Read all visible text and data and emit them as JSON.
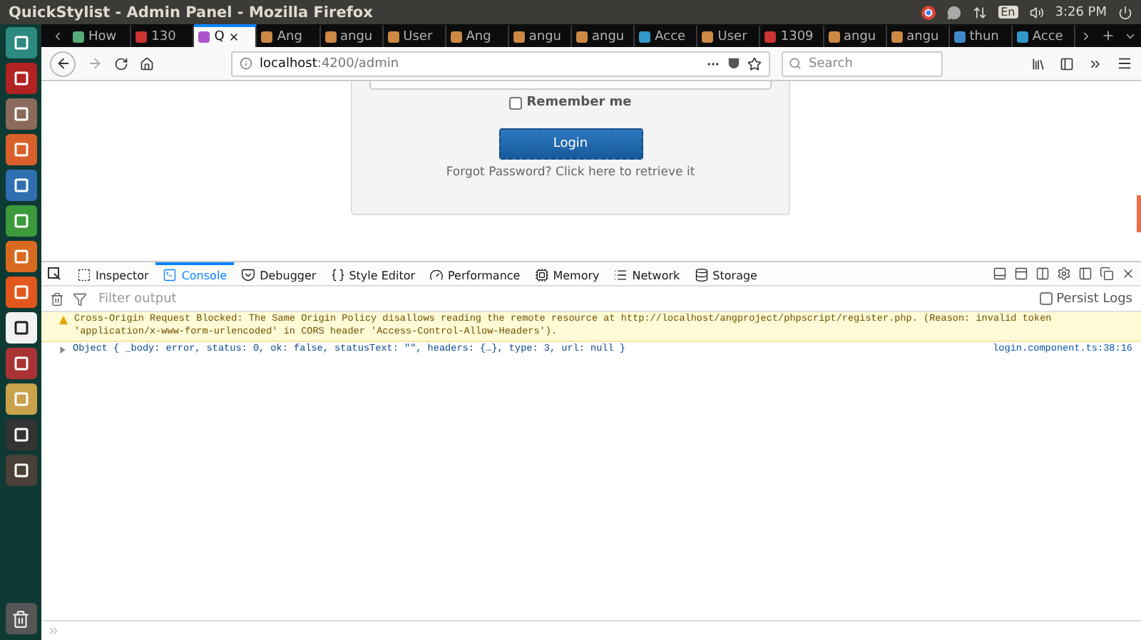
{
  "top_panel": {
    "title": "QuickStylist - Admin Panel - Mozilla Firefox",
    "keyboard_layout": "En",
    "clock": "3:26 PM"
  },
  "tabs": [
    {
      "label": "How",
      "selected": false
    },
    {
      "label": "130",
      "selected": false
    },
    {
      "label": "Q",
      "selected": true
    },
    {
      "label": "Ang",
      "selected": false
    },
    {
      "label": "angu",
      "selected": false
    },
    {
      "label": "User",
      "selected": false
    },
    {
      "label": "Ang",
      "selected": false
    },
    {
      "label": "angu",
      "selected": false
    },
    {
      "label": "angu",
      "selected": false
    },
    {
      "label": "Acce",
      "selected": false
    },
    {
      "label": "User",
      "selected": false
    },
    {
      "label": "1309",
      "selected": false
    },
    {
      "label": "angu",
      "selected": false
    },
    {
      "label": "angu",
      "selected": false
    },
    {
      "label": "thun",
      "selected": false
    },
    {
      "label": "Acce",
      "selected": false
    }
  ],
  "address_bar": {
    "host": "localhost",
    "path": ":4200/admin"
  },
  "search": {
    "placeholder": "Search"
  },
  "login": {
    "remember": {
      "label": "Remember me",
      "checked": false
    },
    "button": "Login",
    "forgot": "Forgot Password? Click here to retrieve it"
  },
  "devtools": {
    "tabs": [
      {
        "label": "Inspector",
        "selected": false
      },
      {
        "label": "Console",
        "selected": true
      },
      {
        "label": "Debugger",
        "selected": false
      },
      {
        "label": "Style Editor",
        "selected": false
      },
      {
        "label": "Performance",
        "selected": false
      },
      {
        "label": "Memory",
        "selected": false
      },
      {
        "label": "Network",
        "selected": false
      },
      {
        "label": "Storage",
        "selected": false
      }
    ],
    "filter": {
      "placeholder": "Filter output"
    },
    "persist_logs": {
      "label": "Persist Logs",
      "checked": false
    },
    "messages": [
      {
        "kind": "warning",
        "text": "Cross-Origin Request Blocked: The Same Origin Policy disallows reading the remote resource at http://localhost/angproject/phpscript/register.php. (Reason: invalid token 'application/x-www-form-urlencoded' in CORS header 'Access-Control-Allow-Headers')."
      },
      {
        "kind": "log",
        "text": "Object { _body: error, status: 0, ok: false, statusText: \"\", headers: {…}, type: 3, url: null }",
        "source": "login.component.ts:38:16"
      }
    ]
  }
}
